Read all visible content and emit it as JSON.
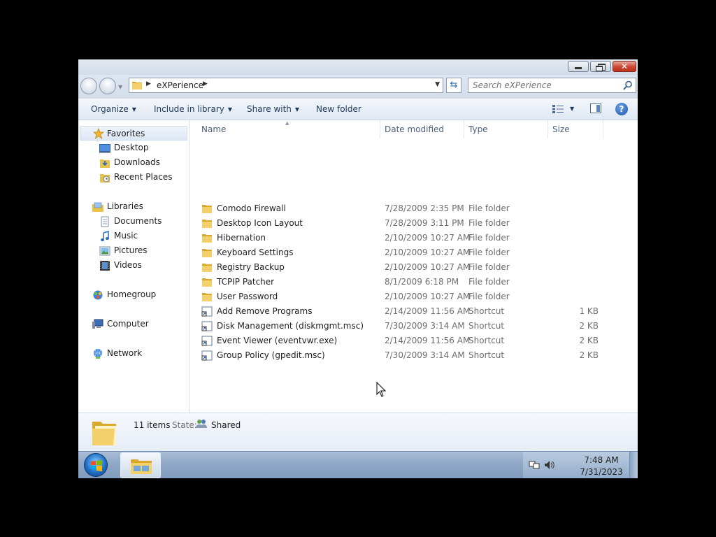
{
  "window": {
    "buttons": {
      "minimize": "minimize",
      "maximize": "restore",
      "close": "close"
    }
  },
  "address": {
    "crumb": "eXPerience",
    "search_placeholder": "Search eXPerience"
  },
  "toolbar": {
    "organize": "Organize",
    "include": "Include in library",
    "share": "Share with",
    "newfolder": "New folder"
  },
  "nav": {
    "favorites": "Favorites",
    "desktop": "Desktop",
    "downloads": "Downloads",
    "recent": "Recent Places",
    "libraries": "Libraries",
    "documents": "Documents",
    "music": "Music",
    "pictures": "Pictures",
    "videos": "Videos",
    "homegroup": "Homegroup",
    "computer": "Computer",
    "network": "Network"
  },
  "columns": {
    "name": "Name",
    "date": "Date modified",
    "type": "Type",
    "size": "Size"
  },
  "files": [
    {
      "name": "Comodo Firewall",
      "date": "7/28/2009 2:35 PM",
      "type": "File folder",
      "size": "",
      "icon": "folder"
    },
    {
      "name": "Desktop Icon Layout",
      "date": "7/28/2009 3:11 PM",
      "type": "File folder",
      "size": "",
      "icon": "folder"
    },
    {
      "name": "Hibernation",
      "date": "2/10/2009 10:27 AM",
      "type": "File folder",
      "size": "",
      "icon": "folder"
    },
    {
      "name": "Keyboard Settings",
      "date": "2/10/2009 10:27 AM",
      "type": "File folder",
      "size": "",
      "icon": "folder"
    },
    {
      "name": "Registry Backup",
      "date": "2/10/2009 10:27 AM",
      "type": "File folder",
      "size": "",
      "icon": "folder"
    },
    {
      "name": "TCPIP Patcher",
      "date": "8/1/2009 6:18 PM",
      "type": "File folder",
      "size": "",
      "icon": "folder"
    },
    {
      "name": "User Password",
      "date": "2/10/2009 10:27 AM",
      "type": "File folder",
      "size": "",
      "icon": "folder"
    },
    {
      "name": "Add Remove Programs",
      "date": "2/14/2009 11:56 AM",
      "type": "Shortcut",
      "size": "1 KB",
      "icon": "shortcut"
    },
    {
      "name": "Disk Management (diskmgmt.msc)",
      "date": "7/30/2009 3:14 AM",
      "type": "Shortcut",
      "size": "2 KB",
      "icon": "shortcut"
    },
    {
      "name": "Event Viewer (eventvwr.exe)",
      "date": "2/14/2009 11:56 AM",
      "type": "Shortcut",
      "size": "2 KB",
      "icon": "shortcut"
    },
    {
      "name": "Group Policy (gpedit.msc)",
      "date": "7/30/2009 3:14 AM",
      "type": "Shortcut",
      "size": "2 KB",
      "icon": "shortcut"
    }
  ],
  "details": {
    "count": "11 items",
    "state_label": "State:",
    "state_value": "Shared"
  },
  "taskbar": {
    "time": "7:48 AM",
    "date": "7/31/2023"
  },
  "colors": {
    "folder": "#e8c34a",
    "accent": "#1e395b",
    "taskbar": "#8ea7c6"
  }
}
